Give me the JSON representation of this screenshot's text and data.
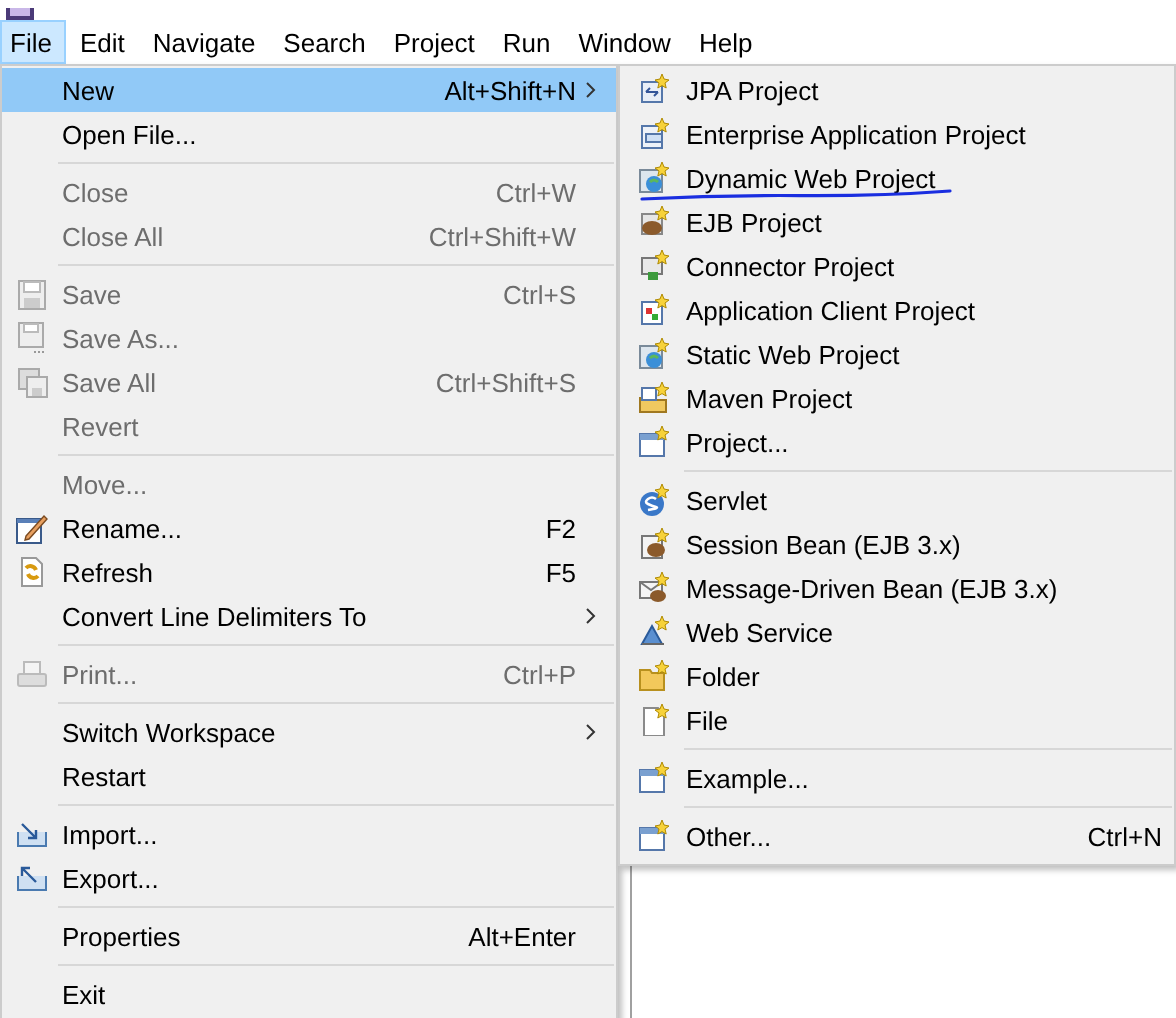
{
  "menubar": [
    {
      "label": "File",
      "selected": true
    },
    {
      "label": "Edit",
      "selected": false
    },
    {
      "label": "Navigate",
      "selected": false
    },
    {
      "label": "Search",
      "selected": false
    },
    {
      "label": "Project",
      "selected": false
    },
    {
      "label": "Run",
      "selected": false
    },
    {
      "label": "Window",
      "selected": false
    },
    {
      "label": "Help",
      "selected": false
    }
  ],
  "file_menu": [
    {
      "kind": "item",
      "label": "New",
      "shortcut": "Alt+Shift+N",
      "submenu": true,
      "disabled": false,
      "selected": true
    },
    {
      "kind": "item",
      "label": "Open File...",
      "submenu": false,
      "disabled": false,
      "selected": false
    },
    {
      "kind": "separator"
    },
    {
      "kind": "item",
      "label": "Close",
      "shortcut": "Ctrl+W",
      "submenu": false,
      "disabled": true,
      "selected": false
    },
    {
      "kind": "item",
      "label": "Close All",
      "shortcut": "Ctrl+Shift+W",
      "submenu": false,
      "disabled": true,
      "selected": false
    },
    {
      "kind": "separator"
    },
    {
      "kind": "item",
      "label": "Save",
      "shortcut": "Ctrl+S",
      "submenu": false,
      "disabled": true,
      "selected": false
    },
    {
      "kind": "item",
      "label": "Save As...",
      "submenu": false,
      "disabled": true,
      "selected": false
    },
    {
      "kind": "item",
      "label": "Save All",
      "shortcut": "Ctrl+Shift+S",
      "submenu": false,
      "disabled": true,
      "selected": false
    },
    {
      "kind": "item",
      "label": "Revert",
      "submenu": false,
      "disabled": true,
      "selected": false
    },
    {
      "kind": "separator"
    },
    {
      "kind": "item",
      "label": "Move...",
      "submenu": false,
      "disabled": true,
      "selected": false
    },
    {
      "kind": "item",
      "label": "Rename...",
      "shortcut": "F2",
      "submenu": false,
      "disabled": false,
      "selected": false
    },
    {
      "kind": "item",
      "label": "Refresh",
      "shortcut": "F5",
      "submenu": false,
      "disabled": false,
      "selected": false
    },
    {
      "kind": "item",
      "label": "Convert Line Delimiters To",
      "submenu": true,
      "disabled": false,
      "selected": false
    },
    {
      "kind": "separator"
    },
    {
      "kind": "item",
      "label": "Print...",
      "shortcut": "Ctrl+P",
      "submenu": false,
      "disabled": true,
      "selected": false
    },
    {
      "kind": "separator"
    },
    {
      "kind": "item",
      "label": "Switch Workspace",
      "submenu": true,
      "disabled": false,
      "selected": false
    },
    {
      "kind": "item",
      "label": "Restart",
      "submenu": false,
      "disabled": false,
      "selected": false
    },
    {
      "kind": "separator"
    },
    {
      "kind": "item",
      "label": "Import...",
      "submenu": false,
      "disabled": false,
      "selected": false
    },
    {
      "kind": "item",
      "label": "Export...",
      "submenu": false,
      "disabled": false,
      "selected": false
    },
    {
      "kind": "separator"
    },
    {
      "kind": "item",
      "label": "Properties",
      "shortcut": "Alt+Enter",
      "submenu": false,
      "disabled": false,
      "selected": false
    },
    {
      "kind": "separator"
    },
    {
      "kind": "item",
      "label": "Exit",
      "submenu": false,
      "disabled": false,
      "selected": false
    }
  ],
  "new_submenu": [
    {
      "kind": "item",
      "label": "JPA Project",
      "annotated": false
    },
    {
      "kind": "item",
      "label": "Enterprise Application Project",
      "annotated": false
    },
    {
      "kind": "item",
      "label": "Dynamic Web Project",
      "annotated": true
    },
    {
      "kind": "item",
      "label": "EJB Project",
      "annotated": false
    },
    {
      "kind": "item",
      "label": "Connector Project",
      "annotated": false
    },
    {
      "kind": "item",
      "label": "Application Client Project",
      "annotated": false
    },
    {
      "kind": "item",
      "label": "Static Web Project",
      "annotated": false
    },
    {
      "kind": "item",
      "label": "Maven Project",
      "annotated": false
    },
    {
      "kind": "item",
      "label": "Project...",
      "annotated": false
    },
    {
      "kind": "separator"
    },
    {
      "kind": "item",
      "label": "Servlet",
      "annotated": false
    },
    {
      "kind": "item",
      "label": "Session Bean (EJB 3.x)",
      "annotated": false
    },
    {
      "kind": "item",
      "label": "Message-Driven Bean (EJB 3.x)",
      "annotated": false
    },
    {
      "kind": "item",
      "label": "Web Service",
      "annotated": false
    },
    {
      "kind": "item",
      "label": "Folder",
      "annotated": false
    },
    {
      "kind": "item",
      "label": "File",
      "annotated": false
    },
    {
      "kind": "separator"
    },
    {
      "kind": "item",
      "label": "Example...",
      "annotated": false
    },
    {
      "kind": "separator"
    },
    {
      "kind": "item",
      "label": "Other...",
      "shortcut": "Ctrl+N",
      "annotated": false
    }
  ]
}
